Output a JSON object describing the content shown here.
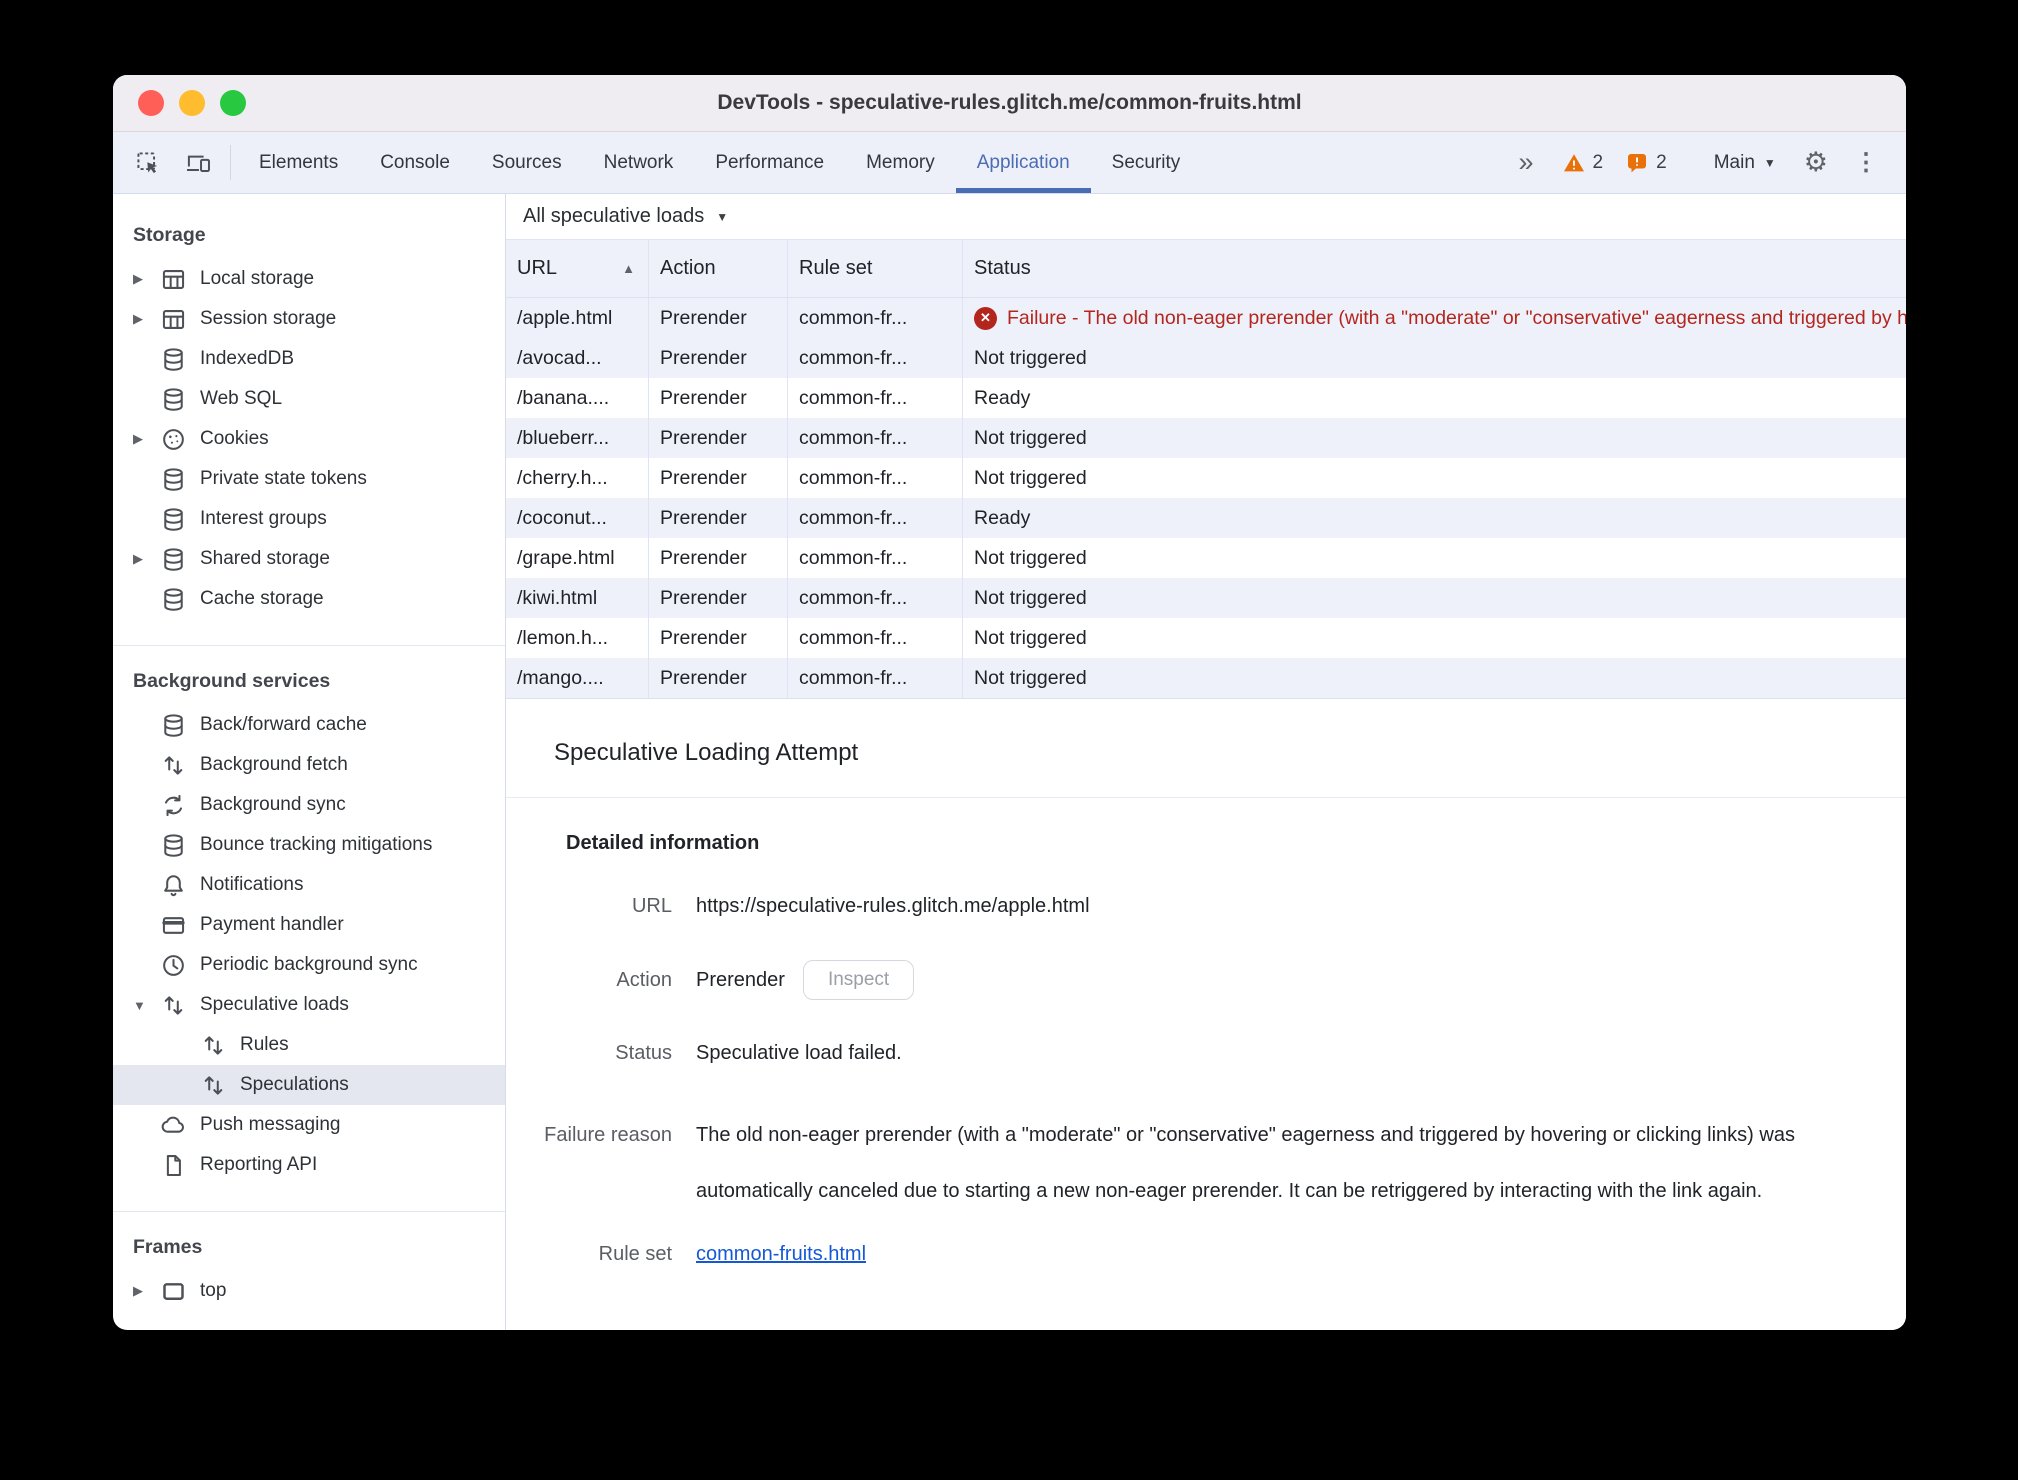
{
  "window": {
    "title": "DevTools - speculative-rules.glitch.me/common-fruits.html"
  },
  "tabbar": {
    "tabs": [
      {
        "label": "Elements",
        "selected": false
      },
      {
        "label": "Console",
        "selected": false
      },
      {
        "label": "Sources",
        "selected": false
      },
      {
        "label": "Network",
        "selected": false
      },
      {
        "label": "Performance",
        "selected": false
      },
      {
        "label": "Memory",
        "selected": false
      },
      {
        "label": "Application",
        "selected": true
      },
      {
        "label": "Security",
        "selected": false
      }
    ],
    "more_tabs_glyph": "»",
    "warnings": {
      "icon": "warning-triangle-icon",
      "count": "2"
    },
    "issues": {
      "icon": "issues-bubble-icon",
      "count": "2"
    },
    "main_menu": {
      "label": "Main"
    },
    "icons": [
      "inspect-icon",
      "device-toolbar-icon",
      "gear-icon",
      "kebab-menu-icon"
    ]
  },
  "sidebar": {
    "sections": [
      {
        "title": "Storage",
        "items": [
          {
            "label": "Local storage",
            "icon": "table",
            "twisty": "collapsed"
          },
          {
            "label": "Session storage",
            "icon": "table",
            "twisty": "collapsed"
          },
          {
            "label": "IndexedDB",
            "icon": "database"
          },
          {
            "label": "Web SQL",
            "icon": "database"
          },
          {
            "label": "Cookies",
            "icon": "cookie",
            "twisty": "collapsed"
          },
          {
            "label": "Private state tokens",
            "icon": "database"
          },
          {
            "label": "Interest groups",
            "icon": "database"
          },
          {
            "label": "Shared storage",
            "icon": "database",
            "twisty": "collapsed"
          },
          {
            "label": "Cache storage",
            "icon": "database"
          }
        ]
      },
      {
        "title": "Background services",
        "items": [
          {
            "label": "Back/forward cache",
            "icon": "database"
          },
          {
            "label": "Background fetch",
            "icon": "arrows-updown"
          },
          {
            "label": "Background sync",
            "icon": "sync"
          },
          {
            "label": "Bounce tracking mitigations",
            "icon": "database"
          },
          {
            "label": "Notifications",
            "icon": "bell"
          },
          {
            "label": "Payment handler",
            "icon": "payment-card"
          },
          {
            "label": "Periodic background sync",
            "icon": "clock"
          },
          {
            "label": "Speculative loads",
            "icon": "arrows-updown",
            "twisty": "expanded"
          },
          {
            "label": "Rules",
            "icon": "arrows-updown",
            "indent": 1
          },
          {
            "label": "Speculations",
            "icon": "arrows-updown",
            "indent": 1,
            "selected": true
          },
          {
            "label": "Push messaging",
            "icon": "cloud"
          },
          {
            "label": "Reporting API",
            "icon": "document"
          }
        ]
      },
      {
        "title": "Frames",
        "items": [
          {
            "label": "top",
            "icon": "frame",
            "twisty": "collapsed"
          }
        ]
      }
    ]
  },
  "main": {
    "filter": {
      "label": "All speculative loads"
    },
    "table": {
      "columns": [
        "URL",
        "Action",
        "Rule set",
        "Status"
      ],
      "sort_column": "URL",
      "sort_direction": "ascending",
      "rows": [
        {
          "url": "/apple.html",
          "action": "Prerender",
          "rule_set": "common-fr...",
          "status": "Failure - The old non-eager prerender (with a \"moderate\" or \"conservative\" eagerness and triggered by hovering or clicking links) was automatically canceled due to starting a new non-eager prerender.",
          "status_type": "failure",
          "selected": true
        },
        {
          "url": "/avocad...",
          "action": "Prerender",
          "rule_set": "common-fr...",
          "status": "Not triggered",
          "status_type": "not-triggered"
        },
        {
          "url": "/banana....",
          "action": "Prerender",
          "rule_set": "common-fr...",
          "status": "Ready",
          "status_type": "ready"
        },
        {
          "url": "/blueberr...",
          "action": "Prerender",
          "rule_set": "common-fr...",
          "status": "Not triggered",
          "status_type": "not-triggered"
        },
        {
          "url": "/cherry.h...",
          "action": "Prerender",
          "rule_set": "common-fr...",
          "status": "Not triggered",
          "status_type": "not-triggered"
        },
        {
          "url": "/coconut...",
          "action": "Prerender",
          "rule_set": "common-fr...",
          "status": "Ready",
          "status_type": "ready"
        },
        {
          "url": "/grape.html",
          "action": "Prerender",
          "rule_set": "common-fr...",
          "status": "Not triggered",
          "status_type": "not-triggered"
        },
        {
          "url": "/kiwi.html",
          "action": "Prerender",
          "rule_set": "common-fr...",
          "status": "Not triggered",
          "status_type": "not-triggered"
        },
        {
          "url": "/lemon.h...",
          "action": "Prerender",
          "rule_set": "common-fr...",
          "status": "Not triggered",
          "status_type": "not-triggered"
        },
        {
          "url": "/mango....",
          "action": "Prerender",
          "rule_set": "common-fr...",
          "status": "Not triggered",
          "status_type": "not-triggered"
        }
      ]
    },
    "details": {
      "title": "Speculative Loading Attempt",
      "section_title": "Detailed information",
      "url_label": "URL",
      "url_value": "https://speculative-rules.glitch.me/apple.html",
      "action_label": "Action",
      "action_value": "Prerender",
      "inspect_button_label": "Inspect",
      "status_label": "Status",
      "status_value": "Speculative load failed.",
      "failure_label": "Failure reason",
      "failure_value": "The old non-eager prerender (with a \"moderate\" or \"conservative\" eagerness and triggered by hovering or clicking links) was automatically canceled due to starting a new non-eager prerender. It can be retriggered by interacting with the link again.",
      "ruleset_label": "Rule set",
      "ruleset_link": "common-fruits.html"
    }
  },
  "colors": {
    "selected_tab_blue": "#4a6cb3",
    "error_red": "#b3261e",
    "warning_orange": "#e8710a",
    "link_blue": "#1558d6",
    "row_stripe": "#eff1fa",
    "sidebar_selected_bg": "#e4e7ef",
    "traffic_red": "#ff5f57",
    "traffic_yellow": "#febc2e",
    "traffic_green": "#28c840"
  }
}
